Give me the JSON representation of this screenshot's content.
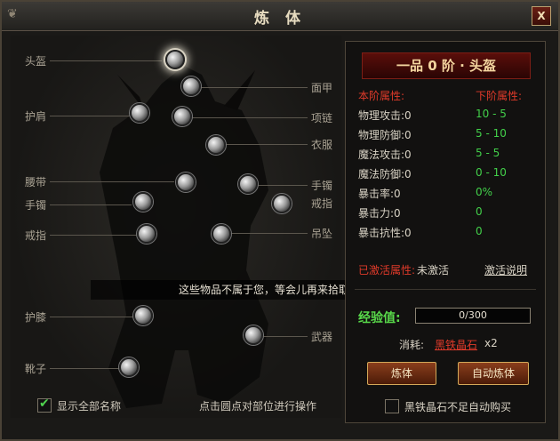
{
  "window": {
    "title": "炼 体",
    "close_label": "X"
  },
  "slots": {
    "helmet": "头盔",
    "face": "面甲",
    "shoulder": "护肩",
    "necklace": "项链",
    "clothes": "衣服",
    "belt": "腰带",
    "bracelet_left": "手镯",
    "bracelet_right": "手镯",
    "ring_left": "戒指",
    "ring_right": "戒指",
    "pendant": "吊坠",
    "knee": "护膝",
    "weapon": "武器",
    "boots": "靴子"
  },
  "notice": "这些物品不属于您，等会儿再来拾取",
  "bottom": {
    "show_names_label": "显示全部名称",
    "show_names_checked": true,
    "hint": "点击圆点对部位进行操作"
  },
  "panel": {
    "banner": "一品 0 阶 · 头盔",
    "current_header": "本阶属性:",
    "next_header": "下阶属性:",
    "attributes": [
      {
        "name": "物理攻击:0",
        "next": "10 - 5"
      },
      {
        "name": "物理防御:0",
        "next": "5 - 10"
      },
      {
        "name": "魔法攻击:0",
        "next": "5 - 5"
      },
      {
        "name": "魔法防御:0",
        "next": "0 - 10"
      },
      {
        "name": "暴击率:0",
        "next": "0%"
      },
      {
        "name": "暴击力:0",
        "next": "0"
      },
      {
        "name": "暴击抗性:0",
        "next": "0"
      }
    ],
    "activated_label": "已激活属性:",
    "activated_value": "未激活",
    "activate_help": "激活说明",
    "xp_label": "经验值:",
    "xp_text": "0/300",
    "xp_fraction": 0,
    "cost_label": "消耗:",
    "cost_item": "黑铁晶石",
    "cost_qty": "x2",
    "refine_button": "炼体",
    "auto_refine_button": "自动炼体",
    "auto_buy_label": "黑铁晶石不足自动购买",
    "auto_buy_checked": false
  },
  "watermark": "jingyan.baidu.com"
}
